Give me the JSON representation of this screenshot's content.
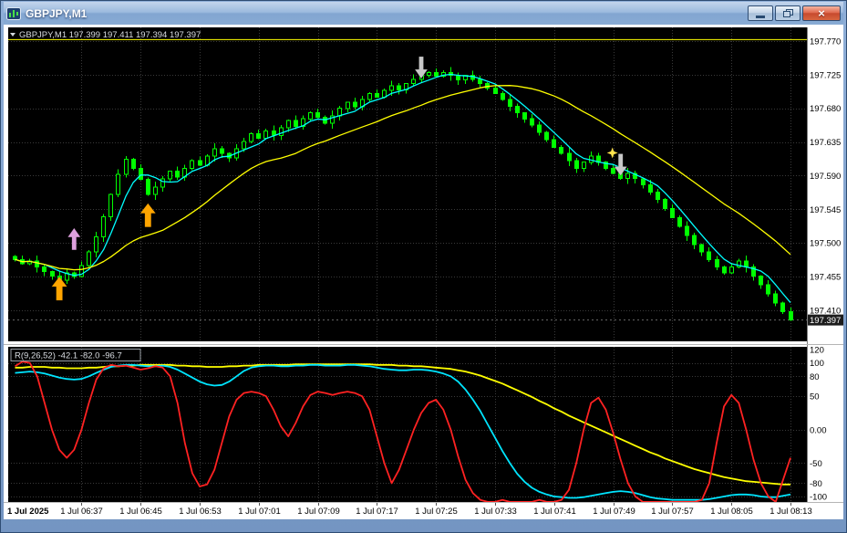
{
  "window": {
    "title": "GBPJPY,M1",
    "controls": {
      "minimize": "minimize",
      "restore": "restore",
      "close_glyph": "×"
    }
  },
  "chart": {
    "quote_line": "GBPJPY,M1 197.399 197.411 197.394 197.397"
  },
  "chart_data": {
    "type": "candlestick",
    "symbol": "GBPJPY",
    "timeframe": "M1",
    "price_axis": {
      "labels": [
        "197.770",
        "197.725",
        "197.680",
        "197.635",
        "197.590",
        "197.545",
        "197.500",
        "197.455",
        "197.410"
      ],
      "current": "197.397"
    },
    "time_axis": {
      "labels": [
        "1 Jul 2025",
        "1 Jul 06:37",
        "1 Jul 06:45",
        "1 Jul 06:53",
        "1 Jul 07:01",
        "1 Jul 07:09",
        "1 Jul 07:17",
        "1 Jul 07:25",
        "1 Jul 07:33",
        "1 Jul 07:41",
        "1 Jul 07:49",
        "1 Jul 07:57",
        "1 Jul 08:05",
        "1 Jul 08:13"
      ]
    },
    "price_base": 197.0,
    "first_open_pips": 482,
    "closes_pips": [
      478,
      472,
      476,
      468,
      462,
      456,
      450,
      460,
      455,
      470,
      488,
      508,
      535,
      565,
      592,
      612,
      600,
      585,
      565,
      575,
      586,
      596,
      588,
      600,
      610,
      604,
      616,
      626,
      620,
      614,
      626,
      636,
      646,
      640,
      650,
      644,
      654,
      664,
      656,
      666,
      674,
      668,
      660,
      670,
      680,
      688,
      682,
      692,
      700,
      695,
      704,
      710,
      705,
      713,
      719,
      724,
      728,
      723,
      728,
      724,
      718,
      724,
      719,
      713,
      707,
      700,
      692,
      683,
      674,
      666,
      658,
      648,
      638,
      628,
      620,
      610,
      600,
      608,
      616,
      608,
      600,
      593,
      586,
      593,
      586,
      578,
      568,
      558,
      546,
      534,
      522,
      510,
      498,
      488,
      478,
      468,
      460,
      468,
      476,
      468,
      456,
      444,
      432,
      420,
      408,
      397
    ],
    "high_line_price": 197.772,
    "bid_price": 197.397,
    "ma_fast_period": 5,
    "ma_slow_period": 21,
    "oscillator": {
      "label": "R(9,26,52) -42.1 -82.0 -96.7",
      "axis_labels": [
        "120",
        "100",
        "80",
        "50",
        "0.00",
        "-50",
        "-80",
        "-100"
      ],
      "levels": [
        100,
        80,
        50,
        0,
        -50,
        -80,
        -100
      ],
      "red": [
        95,
        102,
        100,
        80,
        40,
        0,
        -30,
        -42,
        -30,
        0,
        40,
        75,
        92,
        97,
        95,
        96,
        93,
        90,
        92,
        95,
        93,
        80,
        40,
        -20,
        -65,
        -85,
        -82,
        -60,
        -20,
        20,
        45,
        55,
        57,
        55,
        50,
        30,
        5,
        -10,
        10,
        35,
        52,
        57,
        55,
        52,
        55,
        57,
        55,
        50,
        30,
        -10,
        -50,
        -80,
        -60,
        -30,
        0,
        25,
        40,
        45,
        30,
        0,
        -40,
        -75,
        -95,
        -105,
        -108,
        -108,
        -105,
        -108,
        -108,
        -108,
        -108,
        -105,
        -108,
        -108,
        -105,
        -90,
        -50,
        0,
        40,
        48,
        30,
        -5,
        -45,
        -80,
        -100,
        -108,
        -108,
        -108,
        -108,
        -108,
        -108,
        -108,
        -108,
        -105,
        -80,
        -20,
        35,
        52,
        40,
        0,
        -45,
        -80,
        -100,
        -108,
        -75,
        -42
      ],
      "cyan": [
        85,
        86,
        87,
        86,
        84,
        81,
        78,
        76,
        75,
        76,
        80,
        85,
        90,
        94,
        96,
        97,
        97,
        96,
        95,
        95,
        96,
        94,
        90,
        84,
        78,
        72,
        68,
        66,
        67,
        72,
        80,
        88,
        93,
        95,
        96,
        96,
        95,
        95,
        96,
        96,
        97,
        97,
        96,
        96,
        96,
        97,
        97,
        96,
        95,
        93,
        91,
        90,
        89,
        89,
        90,
        90,
        89,
        87,
        84,
        80,
        72,
        60,
        45,
        28,
        8,
        -12,
        -32,
        -50,
        -66,
        -78,
        -87,
        -93,
        -97,
        -100,
        -101,
        -102,
        -102,
        -101,
        -99,
        -97,
        -95,
        -93,
        -92,
        -93,
        -95,
        -98,
        -101,
        -103,
        -104,
        -105,
        -105,
        -105,
        -105,
        -105,
        -104,
        -102,
        -100,
        -98,
        -97,
        -97,
        -98,
        -100,
        -101,
        -101,
        -99,
        -97
      ],
      "yellow": [
        93,
        93,
        94,
        94,
        94,
        93,
        93,
        92,
        92,
        92,
        93,
        93,
        94,
        95,
        95,
        96,
        96,
        97,
        97,
        97,
        97,
        97,
        96,
        96,
        95,
        95,
        94,
        94,
        94,
        95,
        95,
        96,
        96,
        97,
        97,
        97,
        97,
        97,
        98,
        98,
        98,
        98,
        98,
        98,
        98,
        98,
        98,
        98,
        98,
        97,
        97,
        97,
        96,
        96,
        95,
        95,
        94,
        93,
        92,
        91,
        89,
        87,
        84,
        81,
        77,
        73,
        69,
        64,
        59,
        54,
        49,
        43,
        38,
        32,
        27,
        21,
        16,
        11,
        6,
        1,
        -4,
        -9,
        -14,
        -19,
        -24,
        -29,
        -34,
        -38,
        -43,
        -47,
        -51,
        -55,
        -59,
        -62,
        -65,
        -68,
        -71,
        -73,
        -75,
        -77,
        -78,
        -79,
        -80,
        -81,
        -82,
        -82
      ]
    },
    "arrows": [
      {
        "name": "buy-arrow-1",
        "dir": "up",
        "index": 6,
        "price": 197.455,
        "color": "#FFA500",
        "size": "large"
      },
      {
        "name": "buy-arrow-2",
        "dir": "up",
        "index": 8,
        "price": 197.52,
        "color": "#DDA0DD",
        "size": "medium"
      },
      {
        "name": "buy-arrow-3",
        "dir": "up",
        "index": 18,
        "price": 197.553,
        "color": "#FFA500",
        "size": "large"
      },
      {
        "name": "sell-arrow-1",
        "dir": "down",
        "index": 55,
        "price": 197.72,
        "color": "#C8C8C8",
        "size": "medium"
      },
      {
        "name": "sell-arrow-2",
        "dir": "down",
        "index": 82,
        "price": 197.59,
        "color": "#C8C8C8",
        "size": "medium",
        "star": "#FFE34D"
      }
    ],
    "colors": {
      "background": "#000000",
      "axis_bg": "#FFFFFF",
      "grid": "#3A3A3A",
      "candle": "#00FF00",
      "ma_fast": "#00FFFF",
      "ma_slow": "#FFFF00",
      "high_line": "#FFFF00",
      "osc_red": "#FF2222",
      "osc_cyan": "#00E5FF",
      "osc_yellow": "#FFFF00",
      "badge_bg": "#1C1C1C",
      "badge_text": "#FFFFFF"
    }
  }
}
